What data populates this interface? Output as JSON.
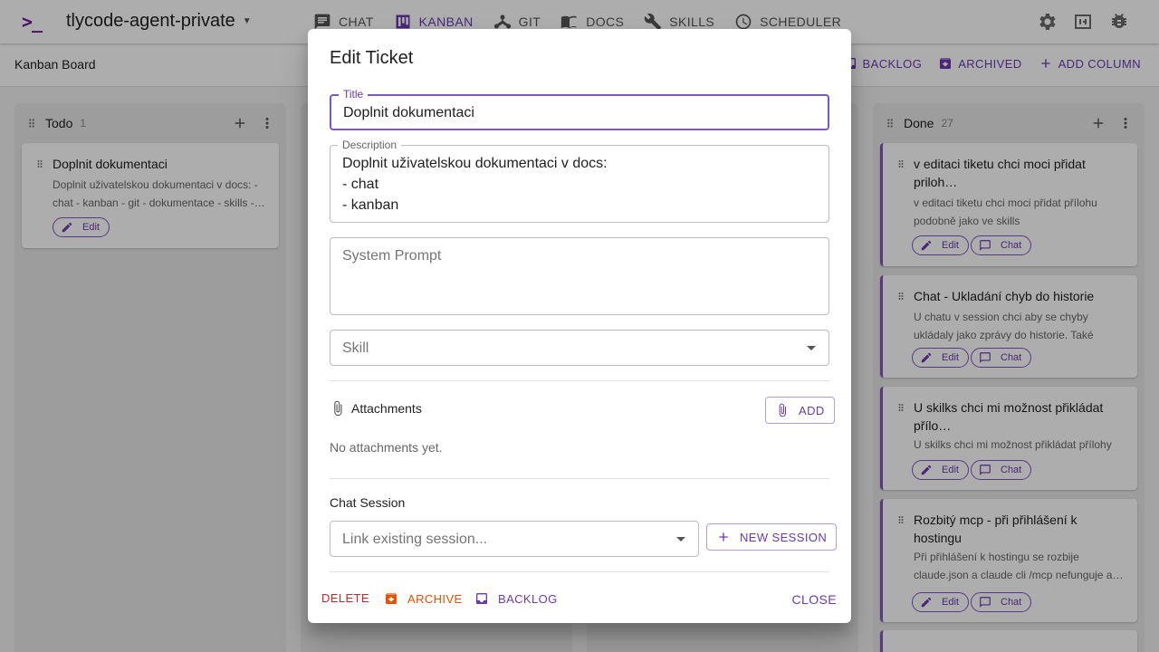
{
  "app": {
    "logo_text": ">_",
    "project_name": "tlycode-agent-private"
  },
  "nav": {
    "items": [
      {
        "label": "CHAT",
        "icon": "chat-icon"
      },
      {
        "label": "KANBAN",
        "icon": "kanban-icon",
        "active": true
      },
      {
        "label": "GIT",
        "icon": "git-icon"
      },
      {
        "label": "DOCS",
        "icon": "docs-icon"
      },
      {
        "label": "SKILLS",
        "icon": "wrench-icon"
      },
      {
        "label": "SCHEDULER",
        "icon": "clock-icon"
      }
    ],
    "right_icons": [
      "settings-icon",
      "terminal-icon",
      "bug-icon"
    ]
  },
  "board": {
    "title": "Kanban Board",
    "actions": [
      {
        "label": "BACKLOG",
        "icon": "inbox-icon"
      },
      {
        "label": "ARCHIVED",
        "icon": "archive-icon"
      },
      {
        "label": "ADD COLUMN",
        "icon": "plus-icon"
      }
    ],
    "columns": [
      {
        "name": "Todo",
        "count": "1",
        "cards": [
          {
            "title": "Doplnit dokumentaci",
            "desc": "Doplnit uživatelskou dokumentaci v docs: - chat - kanban - git - dokumentace - skills -…",
            "buttons": [
              "Edit"
            ]
          }
        ]
      },
      {
        "name": "Done",
        "count": "27",
        "cards": [
          {
            "title": "v editaci tiketu chci moci přidat priloh…",
            "desc": "v editaci tiketu chci moci přidat přílohu podobně jako ve skills",
            "buttons": [
              "Edit",
              "Chat"
            ]
          },
          {
            "title": "Chat - Ukladání chyb do historie",
            "desc": "U chatu v session chci aby se chyby ukládaly jako zprávy do historie. Také chci…",
            "buttons": [
              "Edit",
              "Chat"
            ]
          },
          {
            "title": "U skilks chci mi možnost přikládat přílo…",
            "desc": "U skilks chci mi možnost přikládat přílohy",
            "buttons": [
              "Edit",
              "Chat"
            ]
          },
          {
            "title": "Rozbitý mcp - při přihlášení k hostingu",
            "desc": "Při přihlášení k hostingu se rozbije claude.json a claude cli /mcp nefunguje a…",
            "buttons": [
              "Edit",
              "Chat"
            ]
          }
        ]
      }
    ]
  },
  "dialog": {
    "title": "Edit Ticket",
    "title_field": {
      "label": "Title",
      "value": "Doplnit dokumentaci"
    },
    "description_field": {
      "label": "Description",
      "value": "Doplnit uživatelskou dokumentaci v docs:\n- chat\n- kanban"
    },
    "system_prompt_field": {
      "placeholder": "System Prompt"
    },
    "skill_field": {
      "placeholder": "Skill"
    },
    "attachments": {
      "label": "Attachments",
      "add_label": "ADD",
      "empty": "No attachments yet."
    },
    "chat_session": {
      "label": "Chat Session",
      "placeholder": "Link existing session...",
      "new_label": "NEW SESSION"
    },
    "footer": {
      "delete": "DELETE",
      "archive": "ARCHIVE",
      "backlog": "BACKLOG",
      "close": "CLOSE"
    },
    "colors": {
      "accent": "#7e57c2",
      "danger": "#c62828",
      "warning": "#e65100"
    }
  }
}
